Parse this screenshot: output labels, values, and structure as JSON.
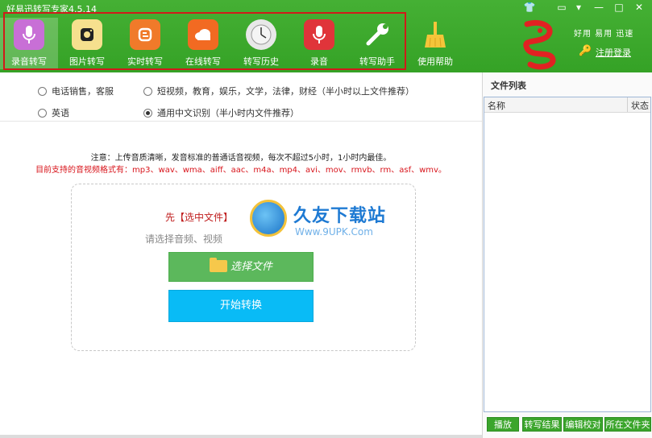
{
  "window": {
    "title": "好易迅转写专家4.5.14",
    "controls": [
      {
        "name": "skin-button",
        "glyph": "👕"
      },
      {
        "name": "message-button",
        "glyph": "▭"
      },
      {
        "name": "menu-button",
        "glyph": "▾"
      },
      {
        "name": "minimize-button",
        "glyph": "—"
      },
      {
        "name": "maximize-button",
        "glyph": "□"
      },
      {
        "name": "close-button",
        "glyph": "✕"
      }
    ]
  },
  "toolbar": {
    "items": [
      {
        "label": "录音转写",
        "icon": "microphone-icon",
        "color": "#c86fd6",
        "active": true
      },
      {
        "label": "图片转写",
        "icon": "camera-icon",
        "color": "#f6e08e"
      },
      {
        "label": "实时转写",
        "icon": "blogger-icon",
        "color": "#f07a2a"
      },
      {
        "label": "在线转写",
        "icon": "cloud-icon",
        "color": "#f26a22"
      },
      {
        "label": "转写历史",
        "icon": "clock-icon",
        "color": "#e8e8e8"
      },
      {
        "label": "录音",
        "icon": "microphone-icon",
        "color": "#e0343a"
      },
      {
        "label": "转写助手",
        "icon": "wrench-icon",
        "color": "#ffffff"
      },
      {
        "label": "使用帮助",
        "icon": "broom-icon",
        "color": "#f5c53a"
      }
    ]
  },
  "brand": {
    "slogan": "好用 易用 迅速",
    "login": "注册登录"
  },
  "options": {
    "radio1": "电话销售，客服",
    "radio2": "短视频，教育，娱乐，文学，法律，财经（半小时以上文件推荐）",
    "radio3": "英语",
    "radio4": "通用中文识别（半小时内文件推荐）",
    "selected": "radio4"
  },
  "notice": "注意：上传音质清晰，发音标准的普通话音视频，每次不超过5小时，1小时内最佳。",
  "formats": "目前支持的音视频格式有：mp3、wav、wma、aiff、aac、m4a、mp4、avi、mov、rmvb、rm、asf、wmv。",
  "upload": {
    "step": "先【选中文件】",
    "hint": "请选择音频、视频",
    "select_button": "选择文件",
    "convert_button": "开始转换"
  },
  "watermark": {
    "brand": "久友下载站",
    "url": "Www.9UPK.Com"
  },
  "filelist": {
    "title": "文件列表",
    "columns": [
      "名称",
      "状态"
    ]
  },
  "actions": [
    "播放",
    "转写结果",
    "编辑校对",
    "所在文件夹"
  ]
}
